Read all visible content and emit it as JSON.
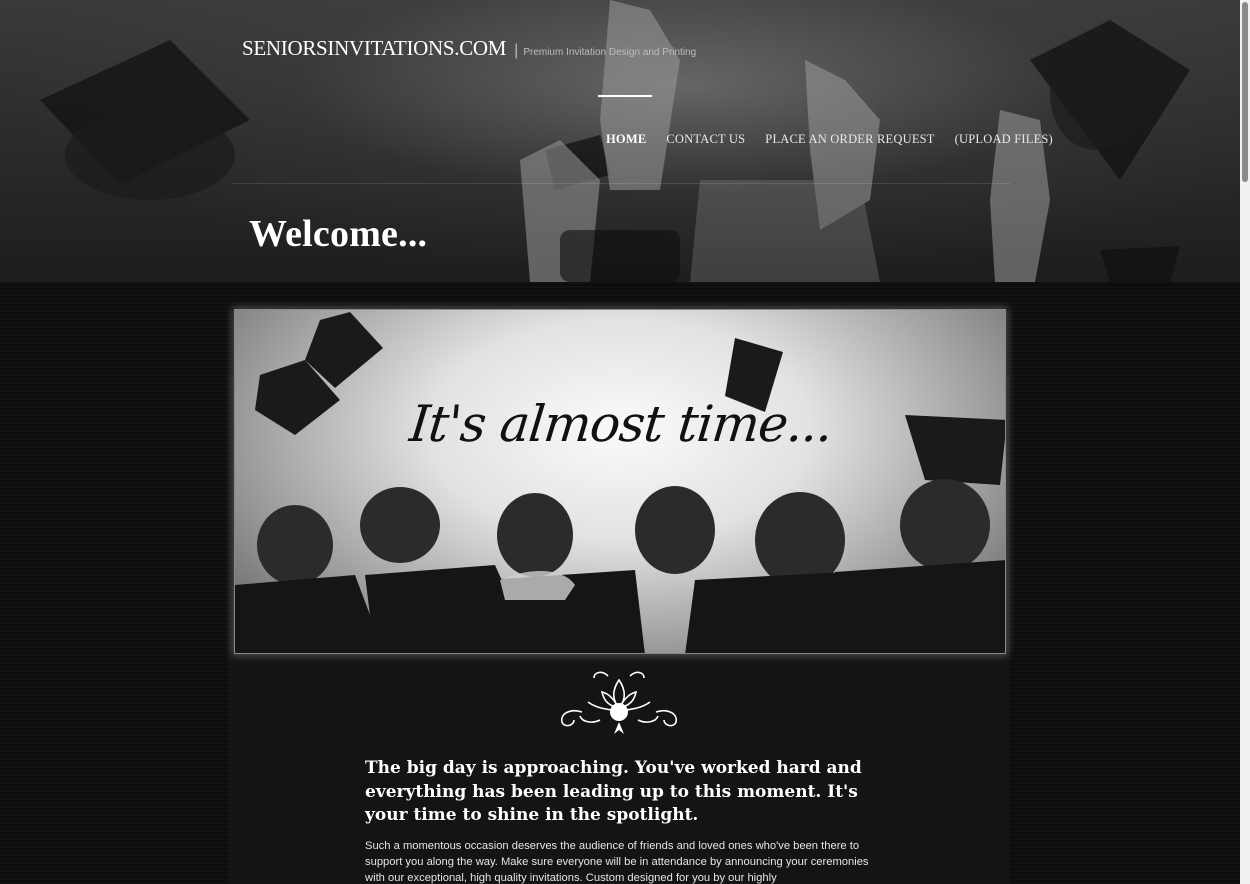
{
  "header": {
    "brand": "SENIORSINVITATIONS.COM",
    "separator": "|",
    "tagline": "Premium Invitation Design and Printing",
    "nav": [
      {
        "label": "HOME",
        "active": true
      },
      {
        "label": "CONTACT US",
        "active": false
      },
      {
        "label": "PLACE AN ORDER REQUEST",
        "active": false
      },
      {
        "label": "(UPLOAD FILES)",
        "active": false
      }
    ],
    "page_title": "Welcome..."
  },
  "banner": {
    "headline": "It's almost time..."
  },
  "content": {
    "lead": "The big day is approaching. You've worked hard and everything has been leading up to this moment. It's your time to shine in the spotlight.",
    "body": "Such a momentous occasion deserves the audience of friends and loved ones who've been there to support you along the way. Make sure everyone will be in attendance by announcing your ceremonies with our exceptional, high quality invitations. Custom designed for you by our highly"
  },
  "colors": {
    "page_bg": "#0b0b0b",
    "text": "#ffffff",
    "nav_indicator": "#ffffff"
  }
}
